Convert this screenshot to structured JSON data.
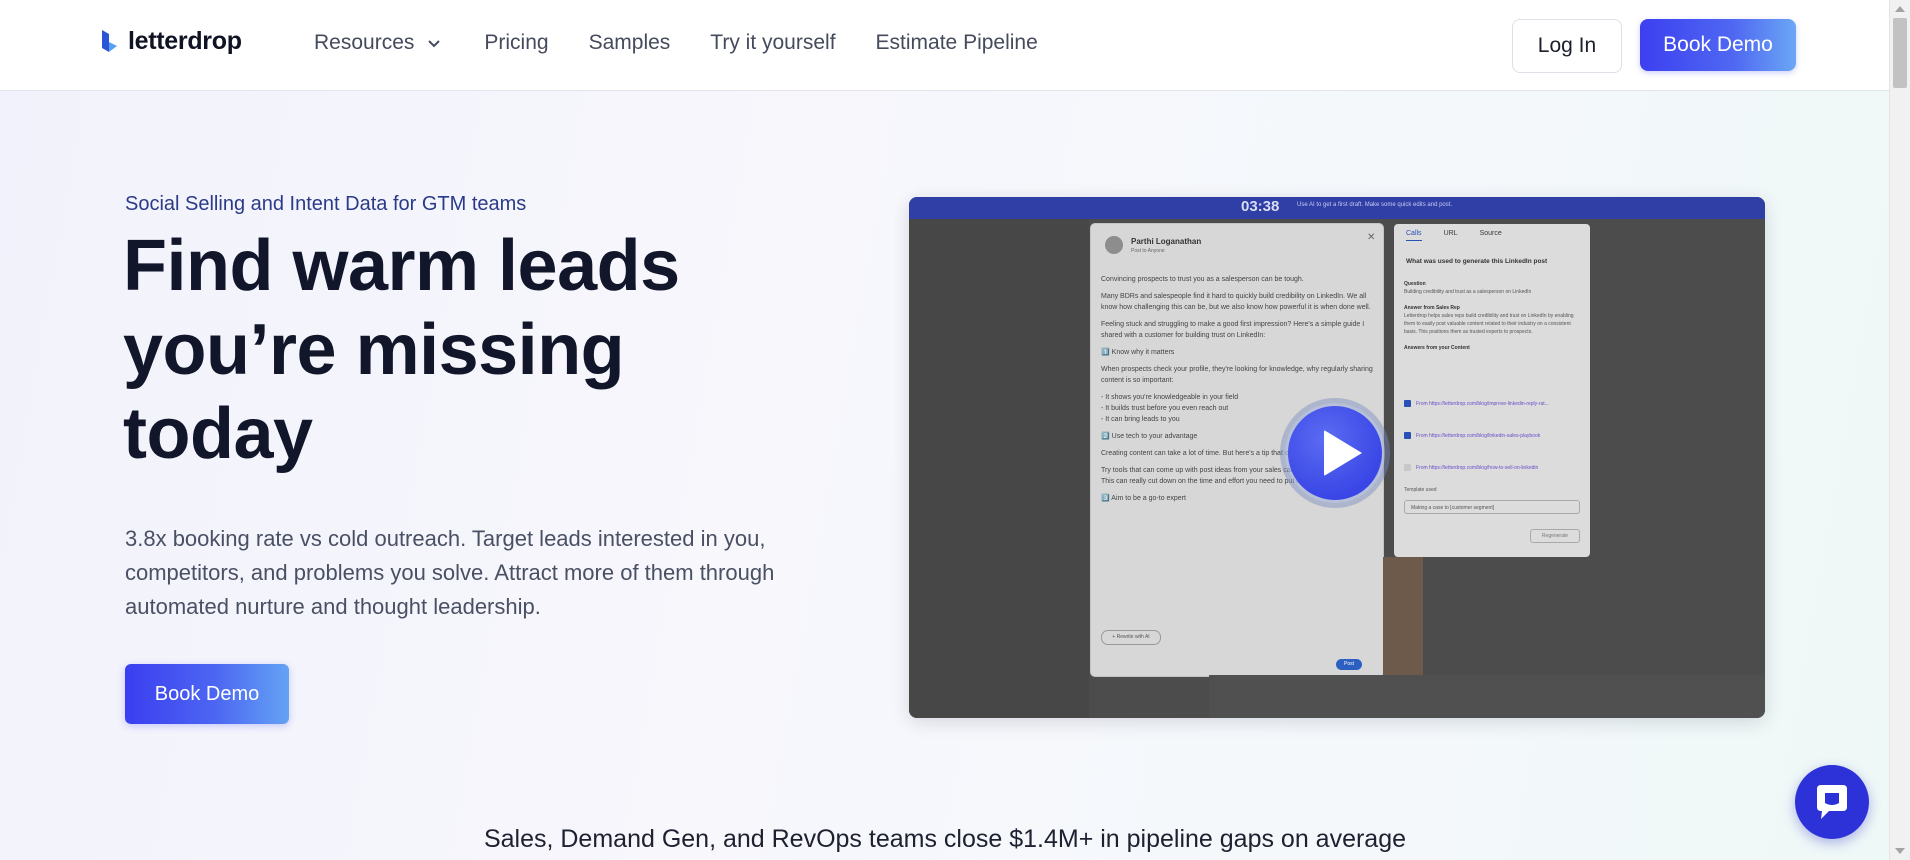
{
  "header": {
    "logo_text": "letterdrop",
    "nav": {
      "resources": "Resources",
      "pricing": "Pricing",
      "samples": "Samples",
      "try_it": "Try it yourself",
      "estimate": "Estimate Pipeline"
    },
    "login_label": "Log In",
    "demo_label": "Book Demo"
  },
  "hero": {
    "eyebrow": "Social Selling and Intent Data for GTM teams",
    "headline": "Find warm leads you’re missing today",
    "subcopy": "3.8x booking rate vs cold outreach. Target leads interested in you, competitors, and problems you solve. Attract more of them through automated nurture and thought leadership.",
    "cta_label": "Book Demo"
  },
  "video": {
    "timer": "03:38",
    "hint": "Use AI to get a first draft. Make some quick edits and post.",
    "post_panel": {
      "author": "Parthi Loganathan",
      "audience": "Post to Anyone",
      "paragraphs": [
        "Convincing prospects to trust you as a salesperson can be tough.",
        "Many BDRs and salespeople find it hard to quickly build credibility on LinkedIn. We all know how challenging this can be, but we also know how powerful it is when done well.",
        "Feeling stuck and struggling to make a good first impression? Here's a simple guide I shared with a customer for building trust on LinkedIn:",
        "1️⃣ Know why it matters",
        "When prospects check your profile, they're looking for knowledge, why regularly sharing content is so important:",
        "- It shows you're knowledgeable in your field\n- It builds trust before you even reach out\n- It can bring leads to you",
        "2️⃣ Use tech to your advantage",
        "Creating content can take a lot of time. But here's a tip that can make a big difference:",
        "Try tools that can come up with post ideas from your sales calls or industry insights. This can really cut down on the time and effort you need to put in.",
        "3️⃣ Aim to be a go-to expert"
      ],
      "rewrite_chip": "+ Rewrite with AI",
      "post_button": "Post"
    },
    "source_panel": {
      "tabs": [
        "Calls",
        "URL",
        "Source"
      ],
      "title": "What was used to generate this LinkedIn post",
      "question_label": "Question",
      "question": "Building credibility and trust as a salesperson on LinkedIn",
      "answer_label": "Answer from Sales Rep",
      "answer": "Letterdrop helps sales reps build credibility and trust on LinkedIn by enabling them to easily post valuable content related to their industry on a consistent basis. This positions them as trusted experts to prospects.",
      "content_label": "Answers from your Content",
      "links": [
        "From https://letterdrop.com/blog/improve-linkedin-reply-rat...",
        "From https://letterdrop.com/blog/linkedin-sales-playbook",
        "From https://letterdrop.com/blog/how-to-sell-on-linkedin"
      ],
      "template_label": "Template used",
      "template_value": "Making a case to [customer segment]",
      "regenerate": "Regenerate"
    }
  },
  "tagline": "Sales, Demand Gen, and RevOps teams close $1.4M+ in pipeline gaps on average",
  "colors": {
    "brand": "#3c3ff0",
    "brand_light": "#6ba7f5",
    "headline": "#12162a",
    "eyebrow": "#2b3a88"
  }
}
